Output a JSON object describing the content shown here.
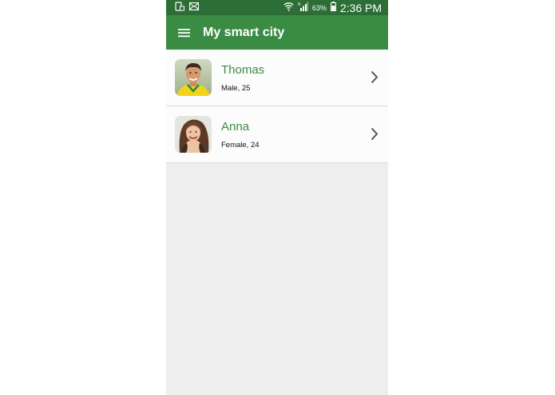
{
  "status_bar": {
    "battery_percent": "63%",
    "time": "2:36 PM",
    "icons": [
      "sim-storage-icon",
      "mail-icon",
      "wifi-icon",
      "signal-icon",
      "battery-icon"
    ]
  },
  "app_bar": {
    "title": "My smart city",
    "menu_icon": "hamburger-menu-icon"
  },
  "people": [
    {
      "name": "Thomas",
      "details": "Male, 25"
    },
    {
      "name": "Anna",
      "details": "Female, 24"
    }
  ],
  "colors": {
    "status_bar": "#2c6e35",
    "app_bar": "#3a8c44",
    "accent_text": "#3a8c44",
    "background": "#eeeeee"
  }
}
